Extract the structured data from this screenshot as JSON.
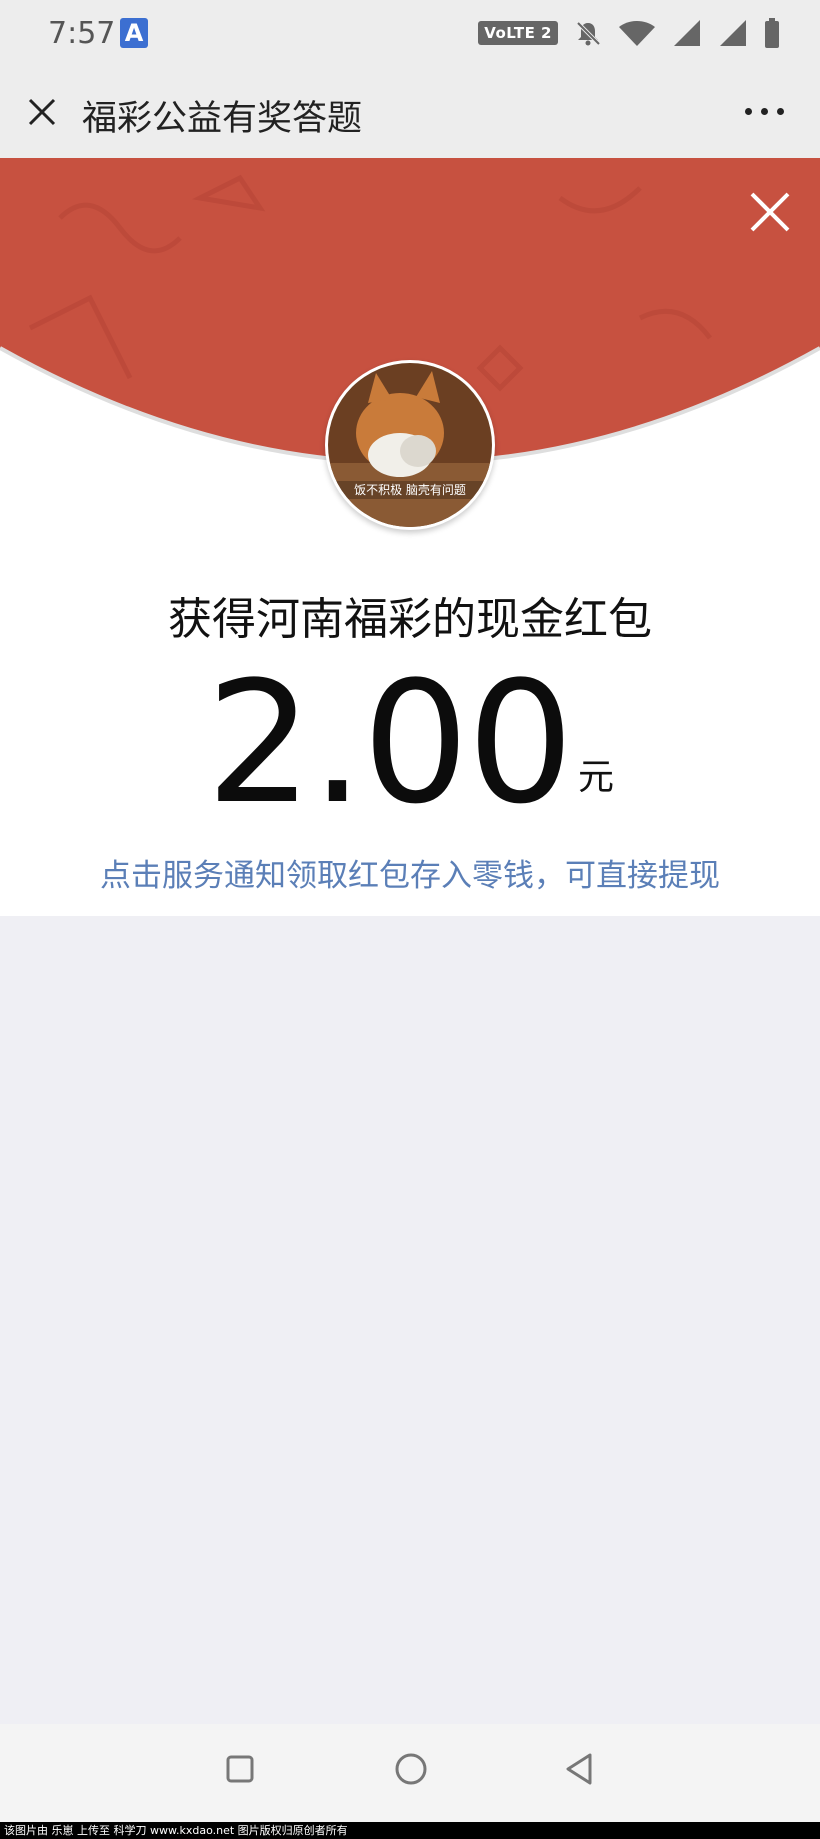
{
  "status_bar": {
    "time": "7:57",
    "app_badge": "A",
    "network_badge": "VoLTE 2",
    "icons": [
      "app-a-icon",
      "bell-off-icon",
      "wifi-icon",
      "signal-icon",
      "signal-icon",
      "battery-icon"
    ]
  },
  "navbar": {
    "title": "福彩公益有奖答题",
    "icons": [
      "close-icon",
      "more-icon"
    ]
  },
  "red_packet": {
    "title": "获得河南福彩的现金红包",
    "amount": "2.00",
    "unit": "元",
    "hint": "点击服务通知领取红包存入零钱，可直接提现",
    "avatar_caption": "饭不积极 脑壳有问题",
    "colors": {
      "header_red": "#c75140",
      "hint_blue": "#5b7fb7",
      "page_bg": "#efeff4"
    },
    "icons": [
      "close-icon",
      "avatar-image"
    ]
  },
  "bottom_nav": {
    "icons": [
      "recent-apps-icon",
      "home-icon",
      "back-icon"
    ]
  },
  "watermark": {
    "text": "该图片由 乐崽 上传至 科学刀 www.kxdao.net 图片版权归原创者所有"
  }
}
